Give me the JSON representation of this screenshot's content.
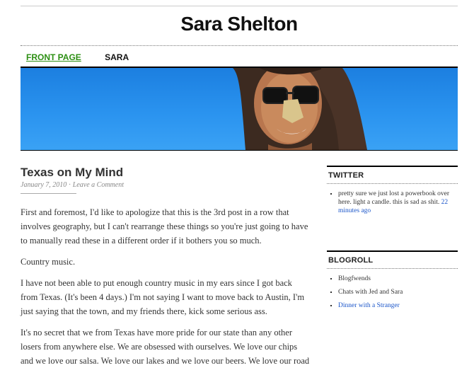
{
  "site": {
    "title": "Sara Shelton"
  },
  "nav": {
    "items": [
      {
        "label": "FRONT PAGE"
      },
      {
        "label": "SARA"
      }
    ]
  },
  "post": {
    "title": "Texas on My Mind",
    "date": "January 7, 2010",
    "separator": "·",
    "comment_link": "Leave a Comment",
    "paragraphs": [
      "First and foremost, I'd like to apologize that this is the 3rd post in a row that involves geography, but I can't rearrange these things so you're just going to have to manually read these in a different order if it bothers you so much.",
      "Country music.",
      "I have not been able to put enough country music in my ears since I got back from Texas. (It's been 4 days.) I'm not saying I want to move back to Austin, I'm just saying that the town, and my friends there, kick some serious ass.",
      "It's no secret that we from Texas have more pride for our state than any other losers from anywhere else. We are obsessed with ourselves. We love our chips and we love our salsa. We love our lakes and we love our beers. We love our road"
    ]
  },
  "sidebar": {
    "twitter": {
      "title": "TWITTER",
      "tweet": "pretty sure we just lost a powerbook over here. light a candle. this is sad as shit.",
      "time": "22 minutes ago"
    },
    "blogroll": {
      "title": "BLOGROLL",
      "items": [
        {
          "label": "Blogfwends"
        },
        {
          "label": "Chats with Jed and Sara"
        },
        {
          "label": "Dinner with a Stranger"
        }
      ]
    }
  }
}
